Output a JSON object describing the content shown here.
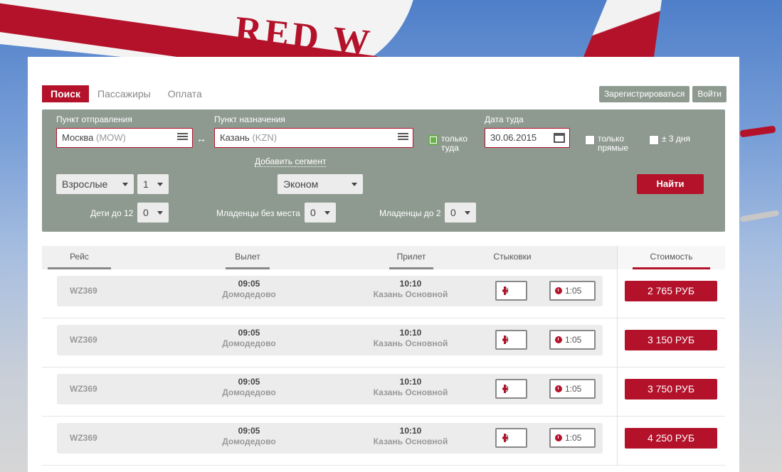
{
  "background": {
    "logo": "RED W"
  },
  "nav": {
    "tabs": [
      "Поиск",
      "Пассажиры",
      "Оплата"
    ],
    "register_label": "Зарегистрироваться",
    "login_label": "Войти"
  },
  "search": {
    "origin_label": "Пункт отправления",
    "origin_city": "Москва",
    "origin_code": "(MOW)",
    "dest_label": "Пункт назначения",
    "dest_city": "Казань",
    "dest_code": "(KZN)",
    "swap_symbol": "↔",
    "one_way_label_1": "только",
    "one_way_label_2": "туда",
    "date_label": "Дата туда",
    "date_value": "30.06.2015",
    "direct_label_1": "только",
    "direct_label_2": "прямые",
    "flex_label": "± 3 дня",
    "add_segment": "Добавить сегмент",
    "adults_label": "Взрослые",
    "adults_count": "1",
    "class_label": "Эконом",
    "children_label": "Дети до 12",
    "children_count": "0",
    "infants_noseat_label": "Младенцы без места",
    "infants_noseat_count": "0",
    "infants_label": "Младенцы до 2",
    "infants_count": "0",
    "find_label": "Найти"
  },
  "results": {
    "headers": {
      "flight": "Рейс",
      "departure": "Вылет",
      "arrival": "Прилет",
      "stops": "Стыковки",
      "price": "Стоимость"
    },
    "rows": [
      {
        "flight": "WZ369",
        "dep_time": "09:05",
        "dep_airport": "Домодедово",
        "arr_time": "10:10",
        "arr_airport": "Казань Основной",
        "stops": "0",
        "duration": "1:05",
        "price": "2 765 РУБ"
      },
      {
        "flight": "WZ369",
        "dep_time": "09:05",
        "dep_airport": "Домодедово",
        "arr_time": "10:10",
        "arr_airport": "Казань Основной",
        "stops": "0",
        "duration": "1:05",
        "price": "3 150 РУБ"
      },
      {
        "flight": "WZ369",
        "dep_time": "09:05",
        "dep_airport": "Домодедово",
        "arr_time": "10:10",
        "arr_airport": "Казань Основной",
        "stops": "0",
        "duration": "1:05",
        "price": "3 750 РУБ"
      },
      {
        "flight": "WZ369",
        "dep_time": "09:05",
        "dep_airport": "Домодедово",
        "arr_time": "10:10",
        "arr_airport": "Казань Основной",
        "stops": "0",
        "duration": "1:05",
        "price": "4 250 РУБ"
      }
    ]
  },
  "colors": {
    "accent": "#b3122a",
    "panel": "#8e9a90"
  }
}
